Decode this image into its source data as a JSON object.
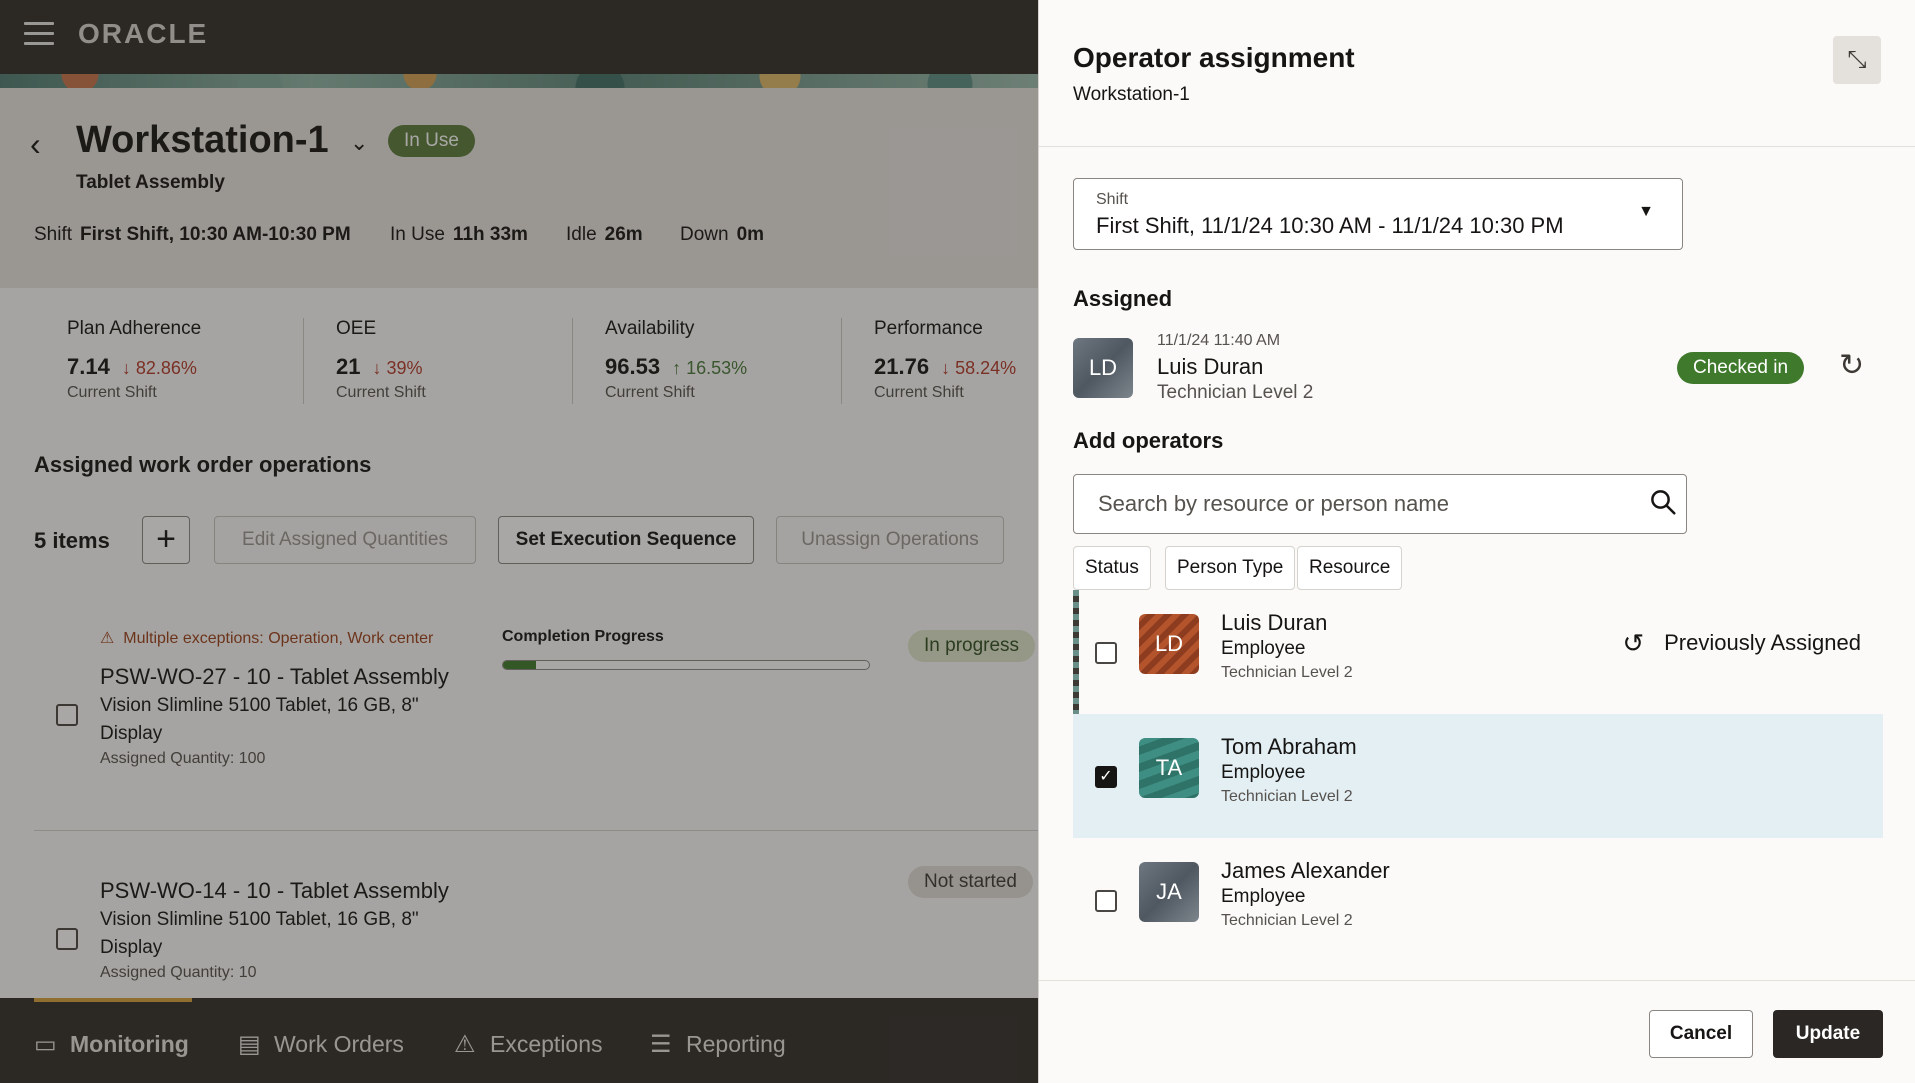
{
  "app": {
    "logo": "ORACLE"
  },
  "workstation": {
    "title": "Workstation-1",
    "status": "In Use",
    "subtitle": "Tablet Assembly",
    "meta": [
      {
        "label": "Shift",
        "value": "First Shift, 10:30 AM-10:30 PM"
      },
      {
        "label": "In Use",
        "value": "11h 33m"
      },
      {
        "label": "Idle",
        "value": "26m"
      },
      {
        "label": "Down",
        "value": "0m"
      }
    ],
    "kpis": [
      {
        "label": "Plan Adherence",
        "value": "7.14",
        "delta": "↓ 82.86%",
        "direction": "down",
        "sub": "Current Shift"
      },
      {
        "label": "OEE",
        "value": "21",
        "delta": "↓ 39%",
        "direction": "down",
        "sub": "Current Shift"
      },
      {
        "label": "Availability",
        "value": "96.53",
        "delta": "↑ 16.53%",
        "direction": "up",
        "sub": "Current Shift"
      },
      {
        "label": "Performance",
        "value": "21.76",
        "delta": "↓ 58.24%",
        "direction": "down",
        "sub": "Current Shift"
      }
    ]
  },
  "operations": {
    "title": "Assigned work order operations",
    "count": "5 items",
    "toolbar": {
      "edit": "Edit Assigned Quantities",
      "sequence": "Set Execution Sequence",
      "unassign": "Unassign Operations"
    },
    "items": [
      {
        "exception": "Multiple exceptions: Operation, Work center",
        "title": "PSW-WO-27 - 10 - Tablet Assembly",
        "desc": "Vision Slimline 5100 Tablet, 16 GB, 8\" Display",
        "qty": "Assigned Quantity: 100",
        "progress_label": "Completion Progress",
        "progress": 0.09,
        "status": "In progress"
      },
      {
        "title": "PSW-WO-14 - 10 - Tablet Assembly",
        "desc": "Vision Slimline 5100 Tablet, 16 GB, 8\" Display",
        "qty": "Assigned Quantity: 10",
        "status": "Not started"
      }
    ]
  },
  "nav": [
    {
      "label": "Monitoring",
      "icon": "monitor-icon",
      "active": true
    },
    {
      "label": "Work Orders",
      "icon": "document-icon"
    },
    {
      "label": "Exceptions",
      "icon": "warning-icon"
    },
    {
      "label": "Reporting",
      "icon": "checklist-icon"
    }
  ],
  "drawer": {
    "title": "Operator assignment",
    "subtitle": "Workstation-1",
    "shift": {
      "label": "Shift",
      "value": "First Shift, 11/1/24 10:30 AM - 11/1/24 10:30 PM"
    },
    "assigned_title": "Assigned",
    "assigned": {
      "initials": "LD",
      "time": "11/1/24 11:40 AM",
      "name": "Luis Duran",
      "role": "Technician Level 2",
      "status": "Checked in"
    },
    "add_title": "Add operators",
    "search_placeholder": "Search by resource or person name",
    "filters": [
      "Status",
      "Person Type",
      "Resource"
    ],
    "operators": [
      {
        "initials": "LD",
        "name": "Luis Duran",
        "type": "Employee",
        "level": "Technician Level 2",
        "note": "Previously Assigned",
        "checked": false
      },
      {
        "initials": "TA",
        "name": "Tom Abraham",
        "type": "Employee",
        "level": "Technician Level 2",
        "checked": true
      },
      {
        "initials": "JA",
        "name": "James Alexander",
        "type": "Employee",
        "level": "Technician Level 2",
        "checked": false
      }
    ],
    "cancel": "Cancel",
    "update": "Update"
  },
  "colors": {
    "header": "#312d2a",
    "in_use": "#5a7a3a",
    "checked_in": "#3f7a2c",
    "selected_row": "#e4eff4",
    "primary_button": "#2b2724",
    "negative": "#b33a2a",
    "positive": "#47793a"
  }
}
